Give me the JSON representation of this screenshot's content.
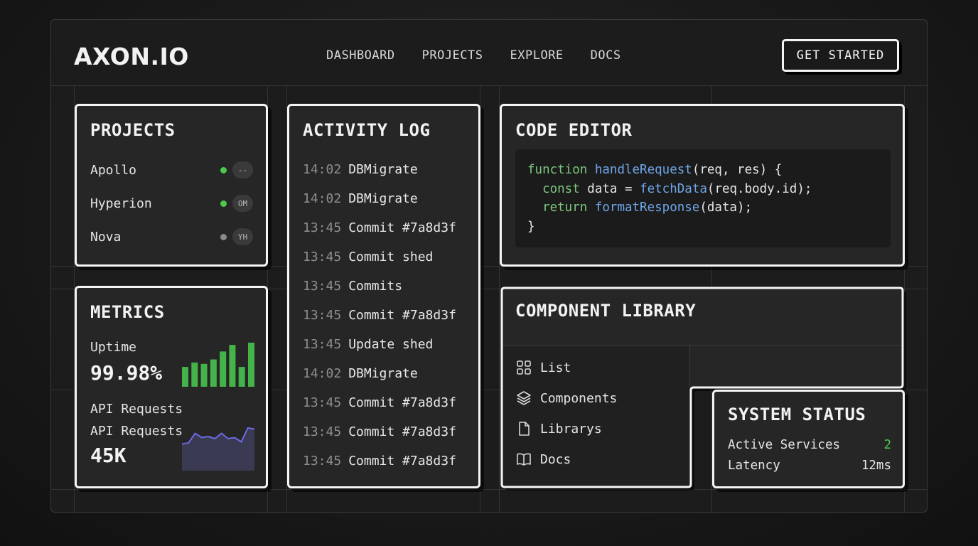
{
  "header": {
    "logo": "AXON.IO",
    "nav": [
      "DASHBOARD",
      "PROJECTS",
      "EXPLORE",
      "DOCS"
    ],
    "cta": "GET STARTED"
  },
  "projects": {
    "title": "PROJECTS",
    "items": [
      {
        "name": "Apollo",
        "status_color": "#4cc94c",
        "badge": "--"
      },
      {
        "name": "Hyperion",
        "status_color": "#4cc94c",
        "badge": "OM"
      },
      {
        "name": "Nova",
        "status_color": "#8a8a8a",
        "badge": "YH"
      }
    ]
  },
  "metrics": {
    "title": "METRICS",
    "uptime_label": "Uptime",
    "uptime_value": "99.98%",
    "api_label_1": "API Requests",
    "api_label_2": "API Requests",
    "api_value": "45K",
    "uptime_bars": [
      0.45,
      0.55,
      0.52,
      0.62,
      0.8,
      0.95,
      0.45,
      1.0
    ],
    "bar_color": "#44b34a",
    "api_sparkline": [
      0.25,
      0.3,
      0.75,
      0.55,
      0.6,
      0.5,
      0.75,
      0.5,
      0.55,
      0.35,
      1.0,
      0.95
    ],
    "spark_color": "#6b6be6"
  },
  "activity": {
    "title": "ACTIVITY LOG",
    "entries": [
      {
        "time": "14:02",
        "msg": "DBMigrate"
      },
      {
        "time": "14:02",
        "msg": "DBMigrate"
      },
      {
        "time": "13:45",
        "msg": "Commit #7a8d3f"
      },
      {
        "time": "13:45",
        "msg": "Commit shed"
      },
      {
        "time": "13:45",
        "msg": "Commits"
      },
      {
        "time": "13:45",
        "msg": "Commit #7a8d3f"
      },
      {
        "time": "13:45",
        "msg": "Update shed"
      },
      {
        "time": "14:02",
        "msg": "DBMigrate"
      },
      {
        "time": "13:45",
        "msg": "Commit #7a8d3f"
      },
      {
        "time": "13:45",
        "msg": "Commit #7a8d3f"
      },
      {
        "time": "13:45",
        "msg": "Commit #7a8d3f"
      }
    ]
  },
  "code": {
    "title": "CODE EDITOR",
    "line1": {
      "kw": "function",
      "fn": "handleRequest",
      "rest": "(req, res) {"
    },
    "line2": {
      "indent": "  ",
      "kw": "const",
      "mid": " data = ",
      "fn": "fetchData",
      "rest": "(req.body.id);"
    },
    "line3": {
      "indent": "  ",
      "kw": "return",
      "fn": "formatResponse",
      "rest": "(data);"
    },
    "line4": "}"
  },
  "library": {
    "title": "COMPONENT LIBRARY",
    "items": [
      {
        "icon": "grid-icon",
        "label": "List"
      },
      {
        "icon": "layers-icon",
        "label": "Components"
      },
      {
        "icon": "file-icon",
        "label": "Librarys"
      },
      {
        "icon": "book-icon",
        "label": "Docs"
      }
    ]
  },
  "status": {
    "title": "SYSTEM STATUS",
    "rows": [
      {
        "label": "Active Services",
        "value": "2",
        "color": "#4cc94c"
      },
      {
        "label": "Latency",
        "value": "12ms",
        "color": "#e6e6e6"
      }
    ]
  }
}
